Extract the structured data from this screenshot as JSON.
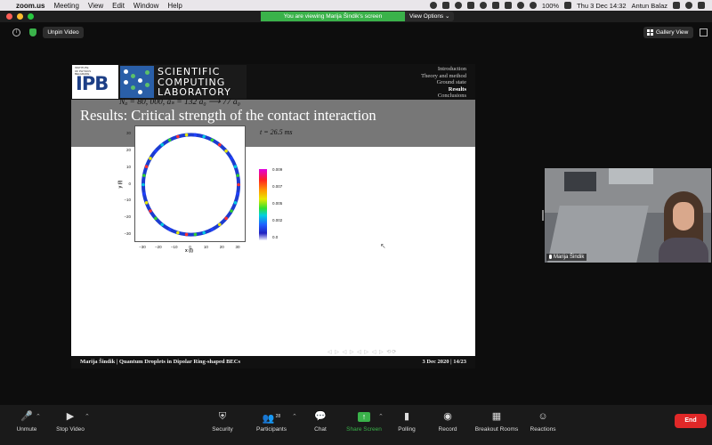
{
  "menubar": {
    "app_name": "zoom.us",
    "menus": [
      "Meeting",
      "View",
      "Edit",
      "Window",
      "Help"
    ],
    "battery": "100%",
    "clock": "Thu 3 Dec  14:32",
    "user": "Antun Balaz"
  },
  "banner": {
    "viewing_text": "You are viewing Marija Šindik's screen",
    "view_options": "View Options ⌄"
  },
  "controls": {
    "unpin_video": "Unpin Video",
    "gallery_view": "Gallery View"
  },
  "slide": {
    "logo_small_text": "INSTITUTE OF PHYSICS BELGRADE",
    "logo_ipb": "IPB",
    "lab_name": [
      "SCIENTIFIC",
      "COMPUTING",
      "LABORATORY"
    ],
    "nav_items": [
      "Introduction",
      "Theory and method",
      "Ground state",
      "Results",
      "Conclusions"
    ],
    "nav_active": "Results",
    "title": "Results: Critical strength of the contact interaction",
    "formula": "Nₐ = 80, 000,     aₛ = 132 a₀ ⟶ 77 a₀",
    "time_label": "t = 26.5  ms",
    "footer_left": "Marija Šindik  |  Quantum Droplets in Dipolar Ring-shaped BECs",
    "footer_right": "3 Dec 2020  | 14/23",
    "beamer_nav": "◁ ▷ ◁ ▷ ◁ ▷ ◁ ▷   ⟲⟳"
  },
  "chart_data": {
    "type": "heatmap",
    "xlabel": "x (l)",
    "ylabel": "y (l)",
    "xticks": [
      "−30",
      "−20",
      "−10",
      "0",
      "10",
      "20",
      "30"
    ],
    "yticks": [
      "30",
      "20",
      "10",
      "0",
      "−10",
      "−20",
      "−30"
    ],
    "xlim": [
      -35,
      35
    ],
    "ylim": [
      -35,
      35
    ],
    "colorbar_ticks": [
      "0.009",
      "0.007",
      "0.005",
      "0.002",
      "0.0"
    ],
    "ring_radius": 30,
    "droplet_count": 34,
    "description_values": {
      "time_ms": 26.5
    }
  },
  "self_video": {
    "name": "Marija Šindik"
  },
  "toolbar": {
    "unmute": "Unmute",
    "stop_video": "Stop Video",
    "security": "Security",
    "participants": "Participants",
    "participants_count": "28",
    "chat": "Chat",
    "share_screen": "Share Screen",
    "polling": "Polling",
    "record": "Record",
    "breakout_rooms": "Breakout Rooms",
    "reactions": "Reactions",
    "end": "End"
  }
}
